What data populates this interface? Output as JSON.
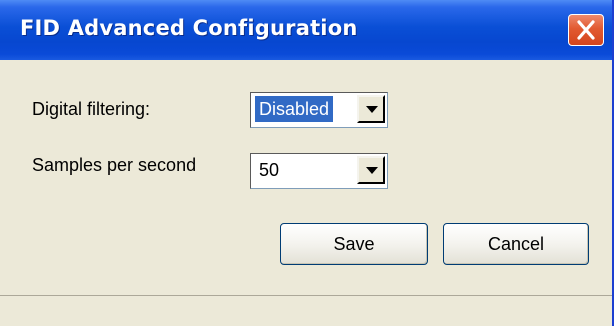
{
  "window": {
    "title": "FID Advanced Configuration",
    "close_icon": "close-icon"
  },
  "form": {
    "digital_filtering": {
      "label": "Digital filtering:",
      "value": "Disabled"
    },
    "samples_per_second": {
      "label": "Samples per second",
      "value": "50"
    }
  },
  "buttons": {
    "save_label": "Save",
    "cancel_label": "Cancel"
  },
  "colors": {
    "titlebar": "#0a4fd6",
    "close_button": "#e25a31",
    "dialog_background": "#ece9d8",
    "selection_highlight": "#316ac5"
  }
}
